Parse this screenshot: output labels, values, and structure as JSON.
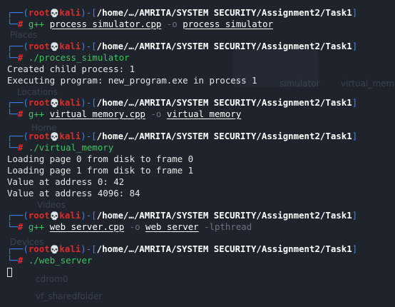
{
  "background": {
    "places_label": "Places",
    "locations_label": "Locations",
    "devices_label": "Devices",
    "videos_label": "Videos",
    "home_label": "Home",
    "cdrom_label": "cdrom0",
    "shared_label": "vf_sharedfolder",
    "simulator_label": "simulator",
    "vm_label": "virtual_mem"
  },
  "prompt": {
    "user": "root",
    "skull": "💀",
    "host": "kali",
    "cwd": "/home/…/AMRITA/SYSTEM SECURITY/Assignment2/Task1",
    "hash": "#"
  },
  "blocks": [
    {
      "command": {
        "bin": "g++",
        "parts": [
          {
            "t": "arg",
            "v": "process_simulator.cpp"
          },
          {
            "t": "flag",
            "v": "-o"
          },
          {
            "t": "arg",
            "v": "process_simulator"
          }
        ]
      },
      "output": []
    },
    {
      "command": {
        "bin": "./process_simulator",
        "parts": []
      },
      "output": [
        "Created child process: 1",
        "Executing program: new_program.exe in process 1"
      ]
    },
    {
      "command": {
        "bin": "g++",
        "parts": [
          {
            "t": "arg",
            "v": "virtual_memory.cpp"
          },
          {
            "t": "flag",
            "v": "-o"
          },
          {
            "t": "arg",
            "v": "virtual_memory"
          }
        ]
      },
      "output": []
    },
    {
      "command": {
        "bin": "./virtual_memory",
        "parts": []
      },
      "output": [
        "Loading page 0 from disk to frame 0",
        "Loading page 1 from disk to frame 1",
        "Value at address 0: 42",
        "Value at address 4096: 84"
      ]
    },
    {
      "command": {
        "bin": "g++",
        "parts": [
          {
            "t": "arg",
            "v": "web_server.cpp"
          },
          {
            "t": "flag",
            "v": "-o"
          },
          {
            "t": "arg",
            "v": "web_server"
          },
          {
            "t": "flag",
            "v": "-lpthread"
          }
        ]
      },
      "output": []
    },
    {
      "command": {
        "bin": "./web_server",
        "parts": []
      },
      "output": []
    }
  ],
  "colors": {
    "background": "#1f232b",
    "frame": "#3b82f6",
    "root": "#e02b2b",
    "command": "#40c463",
    "flag": "#6b7280"
  }
}
